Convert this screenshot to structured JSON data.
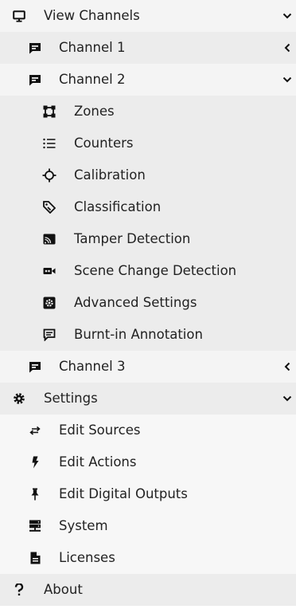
{
  "view_channels": {
    "label": "View Channels",
    "icon": "monitor-icon",
    "expanded": true,
    "channels": [
      {
        "label": "Channel 1",
        "icon": "message-square-icon",
        "expanded": false
      },
      {
        "label": "Channel 2",
        "icon": "message-square-icon",
        "expanded": true,
        "items": [
          {
            "label": "Zones",
            "icon": "vector-square-icon"
          },
          {
            "label": "Counters",
            "icon": "list-icon"
          },
          {
            "label": "Calibration",
            "icon": "crosshair-icon"
          },
          {
            "label": "Classification",
            "icon": "tags-icon"
          },
          {
            "label": "Tamper Detection",
            "icon": "cast-icon"
          },
          {
            "label": "Scene Change Detection",
            "icon": "video-camera-icon"
          },
          {
            "label": "Advanced Settings",
            "icon": "gear-square-icon"
          },
          {
            "label": "Burnt-in Annotation",
            "icon": "comment-text-icon"
          }
        ]
      },
      {
        "label": "Channel 3",
        "icon": "message-square-icon",
        "expanded": false
      }
    ]
  },
  "settings": {
    "label": "Settings",
    "icon": "cog-icon",
    "expanded": true,
    "items": [
      {
        "label": "Edit Sources",
        "icon": "exchange-icon"
      },
      {
        "label": "Edit Actions",
        "icon": "bolt-icon"
      },
      {
        "label": "Edit Digital Outputs",
        "icon": "pin-icon"
      },
      {
        "label": "System",
        "icon": "server-icon"
      },
      {
        "label": "Licenses",
        "icon": "file-icon"
      }
    ]
  },
  "about": {
    "label": "About",
    "icon": "question-mark-icon"
  }
}
